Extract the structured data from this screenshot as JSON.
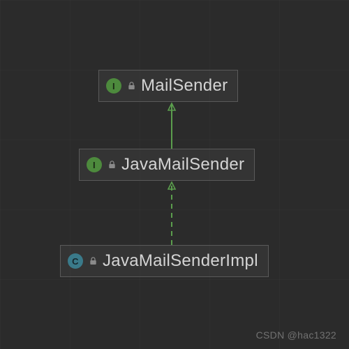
{
  "diagram": {
    "nodes": [
      {
        "kind": "interface",
        "badge": "I",
        "label": "MailSender"
      },
      {
        "kind": "interface",
        "badge": "I",
        "label": "JavaMailSender"
      },
      {
        "kind": "class",
        "badge": "C",
        "label": "JavaMailSenderImpl"
      }
    ],
    "edges": [
      {
        "from": 1,
        "to": 0,
        "style": "solid",
        "meaning": "extends"
      },
      {
        "from": 2,
        "to": 1,
        "style": "dashed",
        "meaning": "implements"
      }
    ]
  },
  "colors": {
    "interface_badge": "#4d8a3d",
    "class_badge": "#3a7a8a",
    "arrow": "#5b9e4d",
    "text": "#d4d4d4",
    "background": "#2b2b2b"
  },
  "watermark": "CSDN @hac1322"
}
